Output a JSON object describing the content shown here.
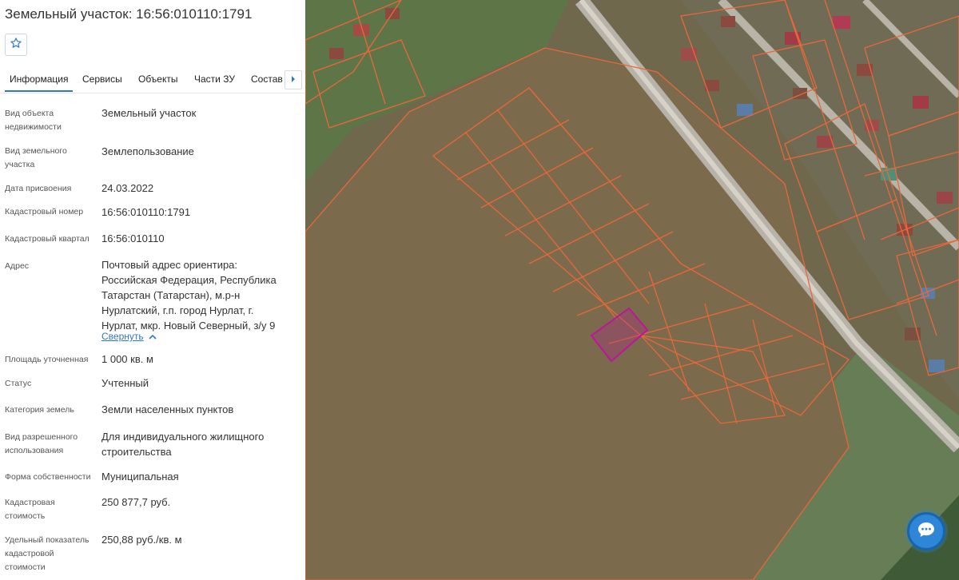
{
  "panel": {
    "title": "Земельный участок: 16:56:010110:1791",
    "tabs": [
      {
        "label": "Информация"
      },
      {
        "label": "Сервисы"
      },
      {
        "label": "Объекты"
      },
      {
        "label": "Части ЗУ"
      },
      {
        "label": "Состав"
      }
    ],
    "fields": {
      "object_type": {
        "label": "Вид объекта недвижимости",
        "value": "Земельный участок"
      },
      "land_type": {
        "label": "Вид земельного участка",
        "value": "Землепользование"
      },
      "assign_date": {
        "label": "Дата присвоения",
        "value": "24.03.2022"
      },
      "cad_number": {
        "label": "Кадастровый номер",
        "value": "16:56:010110:1791"
      },
      "cad_quarter": {
        "label": "Кадастровый квартал",
        "value": "16:56:010110"
      },
      "address": {
        "label": "Адрес",
        "value": "Почтовый адрес ориентира: Российская Федерация, Республика Татарстан (Татарстан), м.р-н Нурлатский, г.п. город Нурлат, г. Нурлат, мкр. Новый Северный, з/у 9"
      },
      "area": {
        "label": "Площадь уточненная",
        "value": "1 000 кв. м"
      },
      "status": {
        "label": "Статус",
        "value": "Учтенный"
      },
      "category": {
        "label": "Категория земель",
        "value": "Земли населенных пунктов"
      },
      "permitted_use": {
        "label": "Вид разрешенного использования",
        "value": "Для индивидуального жилищного строительства"
      },
      "ownership": {
        "label": "Форма собственности",
        "value": "Муниципальная"
      },
      "cad_value": {
        "label": "Кадастровая стоимость",
        "value": "250 877,7 руб."
      },
      "specific_value": {
        "label": "Удельный показатель кадастровой стоимости",
        "value": "250,88 руб./кв. м"
      }
    },
    "collapse_label": "Свернуть"
  },
  "icons": {
    "favorite": "star-outline-icon",
    "tab_scroll": "caret-right-icon",
    "collapse": "chevron-up-icon",
    "chat": "chat-bubble-icon"
  },
  "colors": {
    "accent": "#2f78c4",
    "parcel_outline": "#e8683a",
    "selected_parcel": "#c0149c",
    "field": "#7d6a4b"
  }
}
